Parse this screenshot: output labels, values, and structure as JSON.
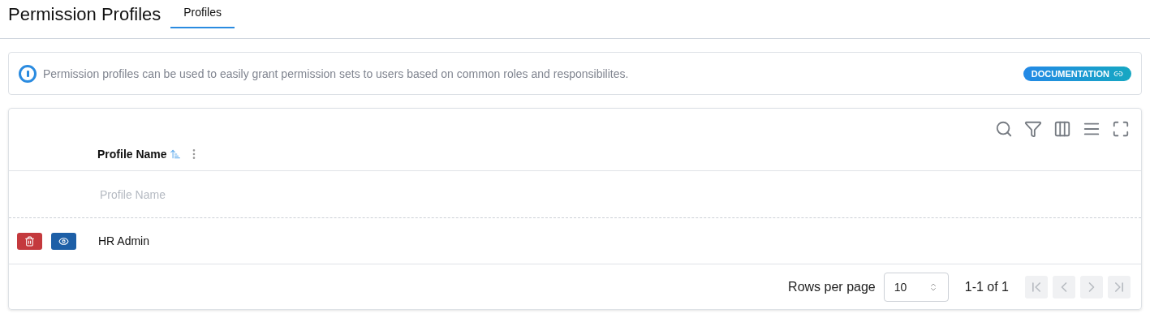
{
  "header": {
    "title": "Permission Profiles",
    "tabs": [
      {
        "label": "Profiles",
        "selected": true
      }
    ]
  },
  "info": {
    "text": "Permission profiles can be used to easily grant permission sets to users based on common roles and responsibilites.",
    "link": "DOCUMENTATION"
  },
  "table": {
    "columns": [
      {
        "label": "Profile Name",
        "sorted": true
      }
    ],
    "filter": {
      "placeholder": "Profile Name"
    },
    "rows": [
      {
        "profile_name": "HR Admin"
      }
    ]
  },
  "pagination": {
    "rows_per_page_label": "Rows per page",
    "rows_per_page": "10",
    "range": "1-1 of 1",
    "buttons": [
      {
        "kind": "first",
        "disabled": true
      },
      {
        "kind": "prev",
        "disabled": true
      },
      {
        "kind": "next",
        "disabled": true
      },
      {
        "kind": "last",
        "disabled": true
      }
    ]
  }
}
